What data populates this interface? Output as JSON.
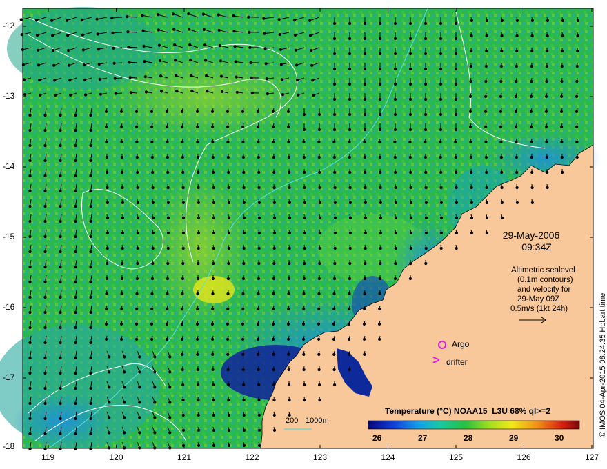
{
  "map": {
    "date": "29-May-2006",
    "time": "09:34Z",
    "info_lines": [
      "Altimetric sealevel",
      "(0.1m contours)",
      "and velocity for",
      "29-May 09Z",
      "0.5m/s (1kt 24h)"
    ],
    "argo_label": "Argo",
    "drifter_label": "drifter",
    "drifter_symbol": ">",
    "depth_labels": [
      "200",
      "1000m"
    ],
    "legend_title": "Temperature (°C) NOAA15_L3U 68% ql>=2",
    "legend_ticks": [
      "26",
      "27",
      "28",
      "29",
      "30"
    ],
    "x_ticks": [
      "119",
      "120",
      "121",
      "122",
      "123",
      "124",
      "125",
      "126",
      "127"
    ],
    "y_ticks": [
      "-12",
      "-13",
      "-14",
      "-15",
      "-16",
      "-17",
      "-18"
    ],
    "credit": "© IMOS 04-Apr-2015 08:24:35 Hobart time",
    "colors": {
      "land": "#f9c89a",
      "ocean_green": "#2fbf3f",
      "ocean_teal": "#1ba88a",
      "warm_yellow": "#d8e81a",
      "cool_blue": "#1e6fd8",
      "deep_blue": "#10229a",
      "contour": "#ffffff",
      "isobath": "#5ee0e0",
      "argo": "#e020e0",
      "drifter": "#e020e0"
    }
  }
}
